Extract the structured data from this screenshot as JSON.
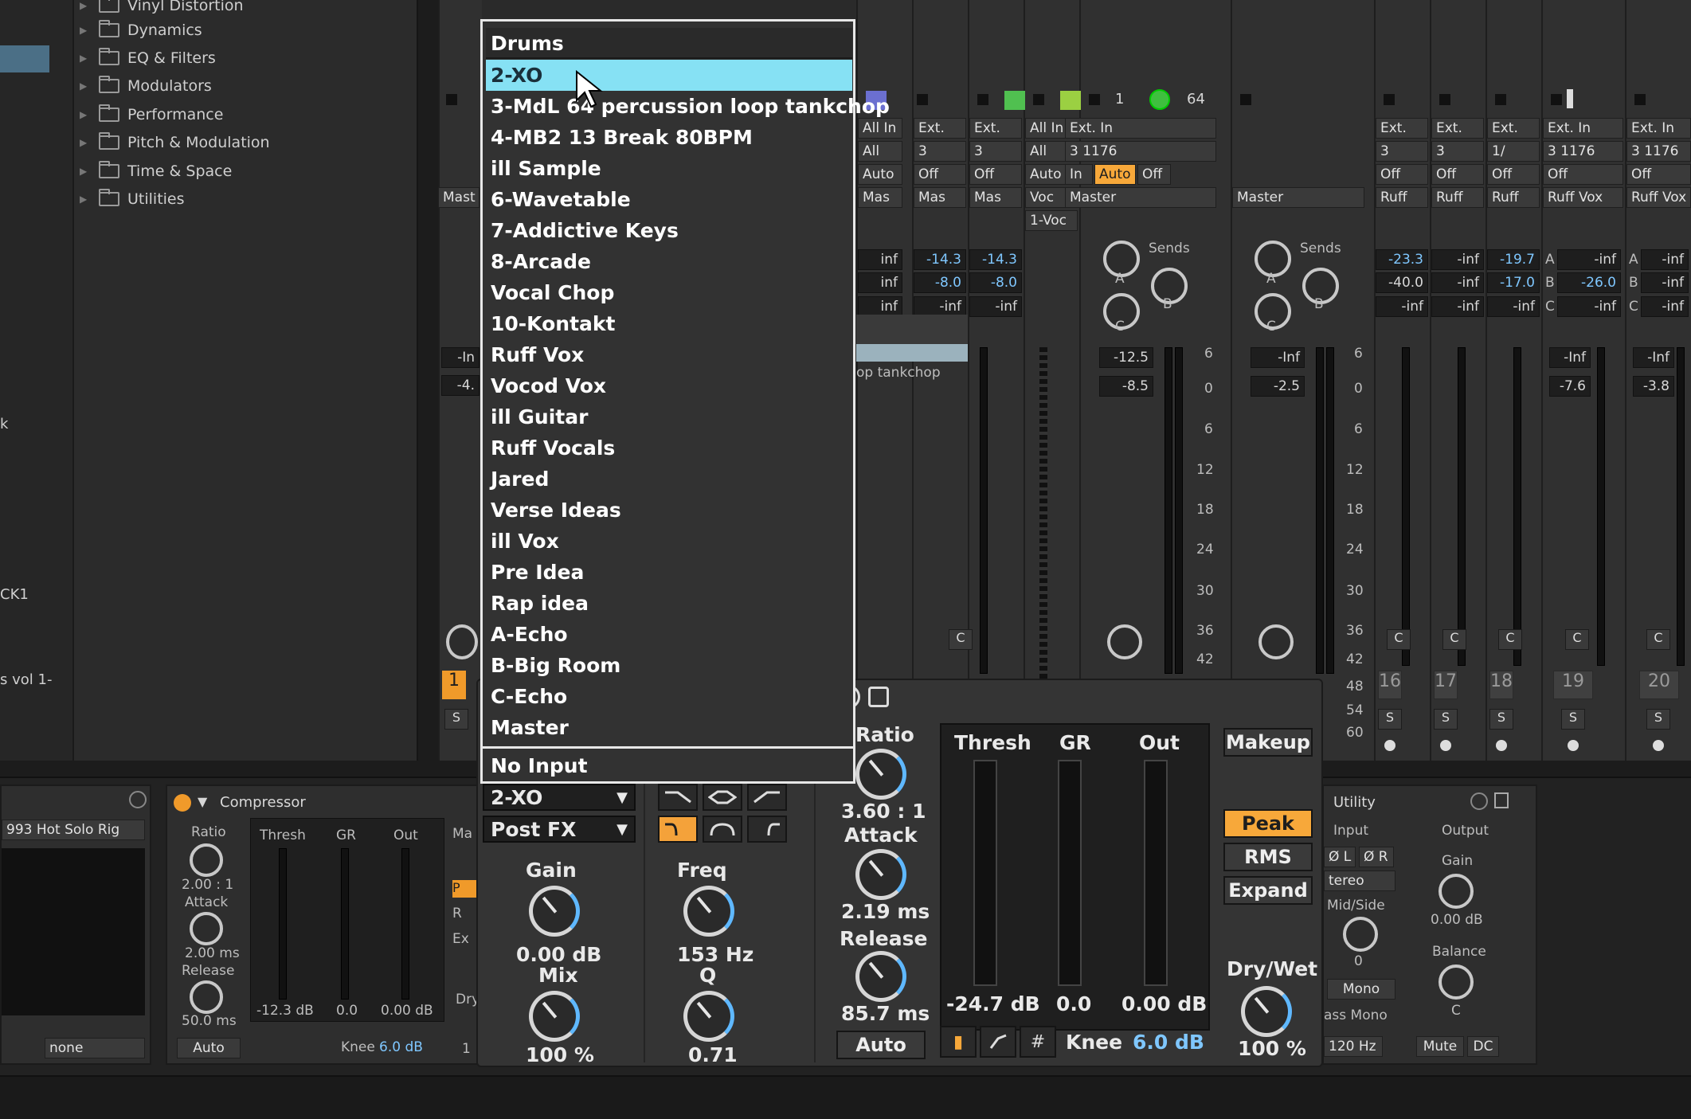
{
  "browser": {
    "items": [
      {
        "label": "Vinyl Distortion"
      },
      {
        "label": "Dynamics"
      },
      {
        "label": "EQ & Filters"
      },
      {
        "label": "Modulators"
      },
      {
        "label": "Performance"
      },
      {
        "label": "Pitch & Modulation"
      },
      {
        "label": "Time & Space"
      },
      {
        "label": "Utilities"
      }
    ],
    "stubs": [
      "k",
      "CK1",
      "s vol 1-"
    ]
  },
  "mixer": {
    "top_nums": [
      "1",
      "64"
    ],
    "input_chips": [
      "All In",
      "Ext.",
      "Ext.",
      "All In",
      "Ext. In",
      "Ext.",
      "Ext.",
      "Ext.",
      "Ext. In",
      "Ext. In"
    ],
    "channel_chips": [
      "All",
      "3",
      "3",
      "All",
      "3 1176",
      "3",
      "3",
      "1/",
      "3 1176",
      "3 1176"
    ],
    "monitor_chips": [
      "Auto",
      "Off",
      "Off",
      "Auto",
      "In",
      "Auto",
      "Off",
      "Off",
      "Off",
      "Off",
      "Off",
      "Off"
    ],
    "output_chips": [
      "Mas",
      "Mas",
      "Mas",
      "Voc",
      "Master",
      "Master",
      "Ruff",
      "Ruff",
      "Ruff",
      "Ruff Vox",
      "Ruff Vox"
    ],
    "sub_chip": "1-Voc",
    "sends_label": "Sends",
    "send_letters": [
      "A",
      "B",
      "C"
    ],
    "values_row1": [
      "inf",
      "-14.3",
      "-14.3",
      "-23.3",
      "-inf",
      "-19.7",
      "-inf",
      "-inf"
    ],
    "values_row2": [
      "inf",
      "-8.0",
      "-8.0",
      "-40.0",
      "-inf",
      "-17.0",
      "-26.0",
      "-inf"
    ],
    "values_row3": [
      "inf",
      "-inf",
      "-inf",
      "-inf",
      "-inf",
      "-inf",
      "-inf",
      "-inf"
    ],
    "ab_letters": [
      "A",
      "B",
      "C",
      "A",
      "B",
      "C"
    ],
    "vol_values": [
      "-12.5",
      "-8.5",
      "-Inf",
      "-2.5",
      "-Inf",
      "-7.6",
      "-Inf",
      "-3.8"
    ],
    "left_vals": [
      "-In",
      "-4."
    ],
    "left_text": "Mast",
    "scale": [
      "6",
      "0",
      "6",
      "12",
      "18",
      "24",
      "30",
      "36",
      "42",
      "48",
      "54",
      "60"
    ],
    "clip_text": "op tankchop",
    "c_labels": [
      "C",
      "C",
      "C",
      "C",
      "C",
      "C"
    ],
    "s_labels": [
      "S",
      "S",
      "S",
      "S",
      "S",
      "S"
    ],
    "track_nums": [
      "16",
      "17",
      "18",
      "19",
      "20"
    ],
    "left_track_num": "1"
  },
  "dropdown": {
    "header": "Drums",
    "highlighted": "2-XO",
    "items": [
      "3-MdL 64 percussion loop tankchop",
      "4-MB2 13 Break  80BPM",
      "ill Sample",
      "6-Wavetable",
      "7-Addictive Keys",
      "8-Arcade",
      "Vocal Chop",
      "10-Kontakt",
      "Ruff Vox",
      "Vocod Vox",
      "ill Guitar",
      "Ruff Vocals",
      "Jared",
      "Verse Ideas",
      "ill Vox",
      "Pre Idea",
      "Rap idea",
      "A-Echo",
      "B-Big Room",
      "C-Echo",
      "Master"
    ],
    "no_input": "No Input"
  },
  "devices": {
    "left": {
      "title": "993 Hot Solo Rig",
      "none_label": "none"
    },
    "small_comp": {
      "title": "Compressor",
      "ratio_label": "Ratio",
      "ratio": "2.00 : 1",
      "attack_label": "Attack",
      "attack": "2.00 ms",
      "release_label": "Release",
      "release": "50.0 ms",
      "auto": "Auto",
      "thresh_label": "Thresh",
      "gr_label": "GR",
      "out_label": "Out",
      "thresh_val": "-12.3 dB",
      "gr_val": "0.0",
      "out_val": "0.00 dB",
      "knee_label": "Knee",
      "knee_val": "6.0 dB",
      "side_labels": [
        "Ma",
        "P",
        "R",
        "Ex",
        "Dry",
        "1"
      ]
    },
    "utility": {
      "title": "Utility",
      "input_label": "Input",
      "output_label": "Output",
      "phase_l": "Ø L",
      "phase_r": "Ø R",
      "stereo": "tereo",
      "midside": "Mid/Side",
      "width_val": "0",
      "mono": "Mono",
      "bass_mono": "ass Mono",
      "hz": "120 Hz",
      "gain_label": "Gain",
      "gain_val": "0.00 dB",
      "balance_label": "Balance",
      "balance_val": "C",
      "mute": "Mute",
      "dc": "DC"
    }
  },
  "compressor": {
    "sidechain_source": "2-XO",
    "sidechain_tap": "Post FX",
    "gain_label": "Gain",
    "gain_val": "0.00 dB",
    "mix_label": "Mix",
    "mix_val": "100 %",
    "freq_label": "Freq",
    "freq_val": "153 Hz",
    "q_label": "Q",
    "q_val": "0.71",
    "ratio_label": "Ratio",
    "ratio_val": "3.60 : 1",
    "attack_label": "Attack",
    "attack_val": "2.19 ms",
    "release_label": "Release",
    "release_val": "85.7 ms",
    "auto_label": "Auto",
    "thresh_label": "Thresh",
    "gr_label": "GR",
    "out_label": "Out",
    "thresh_val": "-24.7 dB",
    "gr_val": "0.0",
    "out_val": "0.00 dB",
    "knee_label": "Knee",
    "knee_val": "6.0 dB",
    "makeup_label": "Makeup",
    "peak_label": "Peak",
    "rms_label": "RMS",
    "expand_label": "Expand",
    "drywet_label": "Dry/Wet",
    "drywet_val": "100 %",
    "accent": "#f7a83a",
    "highlight": "#86e1f4",
    "value_blue": "#7fc7ff"
  }
}
